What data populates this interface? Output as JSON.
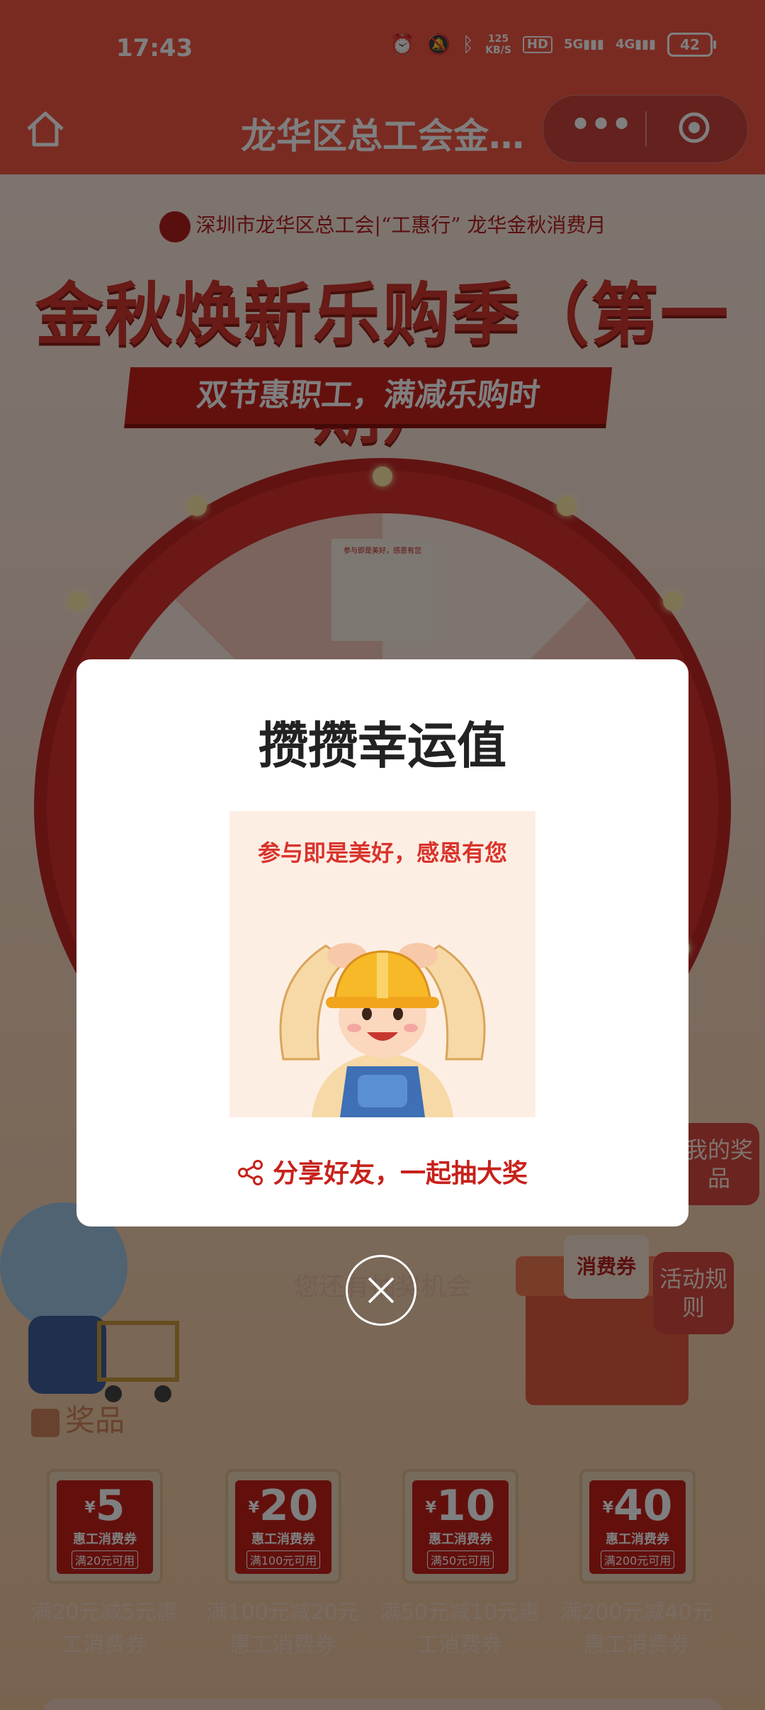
{
  "status_bar": {
    "time": "17:43",
    "net_speed": "125",
    "net_unit": "KB/S",
    "hd_label": "HD",
    "signal_5g": "5G",
    "signal_4g": "4G",
    "battery": "42",
    "icons": [
      "alarm-icon",
      "mute-icon",
      "bluetooth-icon",
      "hd-icon",
      "signal-5g-icon",
      "signal-4g-icon",
      "battery-icon"
    ]
  },
  "navbar": {
    "title": "龙华区总工会金…",
    "home_icon": "home-icon",
    "more_icon": "more-dots-icon",
    "close_icon": "target-close-icon"
  },
  "page": {
    "org_line": "深圳市龙华区总工会|“工惠行” 龙华金秋消费月",
    "headline": "金秋焕新乐购季（第一期）",
    "subtitle": "双节惠职工，满减乐购时",
    "wheel_prize_caption": "参与即是美好，感恩有您",
    "side_my_prizes": "我的奖品",
    "side_rules": "活动规则",
    "voucher_tag": "消费券",
    "remaining_text": "您还有抽奖机会",
    "prizes_title": "奖品",
    "coupons": [
      {
        "symbol": "¥",
        "amount": "5",
        "name": "惠工消费券",
        "condition": "满20元可用",
        "caption": "满20元减5元惠工消费券"
      },
      {
        "symbol": "¥",
        "amount": "20",
        "name": "惠工消费券",
        "condition": "满100元可用",
        "caption": "满100元减20元惠工消费券"
      },
      {
        "symbol": "¥",
        "amount": "10",
        "name": "惠工消费券",
        "condition": "满50元可用",
        "caption": "满50元减10元惠工消费券"
      },
      {
        "symbol": "¥",
        "amount": "40",
        "name": "惠工消费券",
        "condition": "满200元可用",
        "caption": "满200元减40元惠工消费券"
      }
    ]
  },
  "modal": {
    "title": "攒攒幸运值",
    "image_caption": "参与即是美好，感恩有您",
    "share_text": "分享好友，一起抽大奖",
    "share_icon": "share-icon",
    "close_icon": "close-icon"
  },
  "colors": {
    "nav_red": "#f25745",
    "brand_red": "#c7211b",
    "modal_bg": "#ffffff"
  }
}
